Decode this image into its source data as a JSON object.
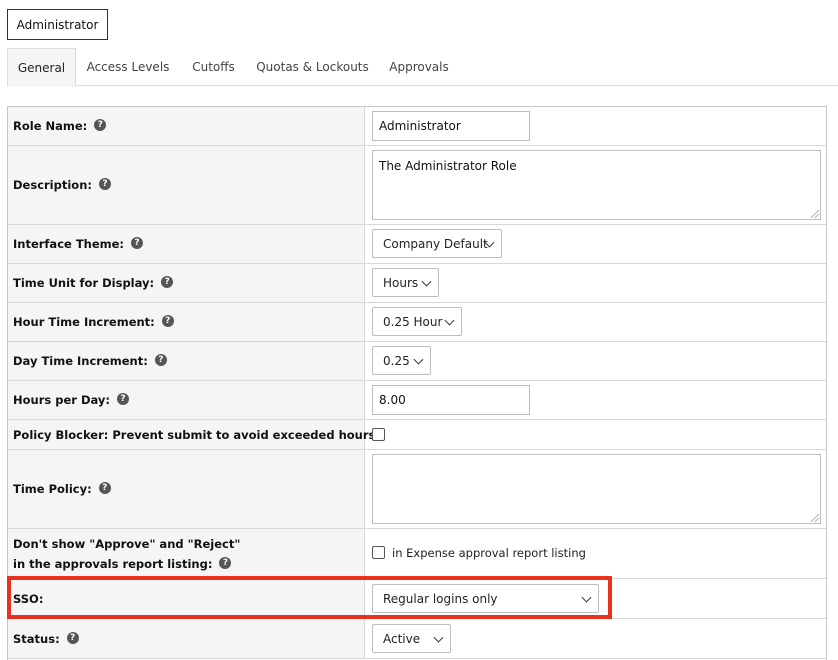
{
  "role_button": {
    "label": "Administrator"
  },
  "tabs": [
    {
      "label": "General",
      "active": true
    },
    {
      "label": "Access Levels",
      "active": false
    },
    {
      "label": "Cutoffs",
      "active": false
    },
    {
      "label": "Quotas & Lockouts",
      "active": false
    },
    {
      "label": "Approvals",
      "active": false
    }
  ],
  "form": {
    "role_name": {
      "label": "Role Name:",
      "value": "Administrator"
    },
    "description": {
      "label": "Description:",
      "value": "The Administrator Role"
    },
    "interface_theme": {
      "label": "Interface Theme:",
      "selected": "Company Default"
    },
    "time_unit": {
      "label": "Time Unit for Display:",
      "selected": "Hours"
    },
    "hour_increment": {
      "label": "Hour Time Increment:",
      "selected": "0.25 Hour"
    },
    "day_increment": {
      "label": "Day Time Increment:",
      "selected": "0.25"
    },
    "hours_per_day": {
      "label": "Hours per Day:",
      "value": "8.00"
    },
    "policy_blocker": {
      "label": "Policy Blocker: Prevent submit to avoid exceeded hours:",
      "checked": false
    },
    "time_policy": {
      "label": "Time Policy:",
      "value": ""
    },
    "approve_reject": {
      "label_line1": "Don't show \"Approve\" and \"Reject\"",
      "label_line2": "in the approvals report listing:",
      "checkbox_label": "in Expense approval report listing",
      "checked": false
    },
    "sso": {
      "label": "SSO:",
      "selected": "Regular logins only"
    },
    "status": {
      "label": "Status:",
      "selected": "Active"
    }
  },
  "help_icon_glyph": "?",
  "colors": {
    "highlight": "#e8321f",
    "label_bg": "#f5f5f5"
  }
}
